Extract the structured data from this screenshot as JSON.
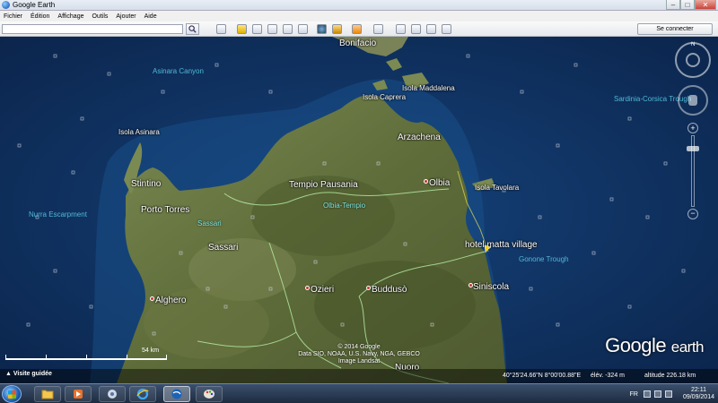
{
  "window": {
    "title": "Google Earth"
  },
  "menu": [
    "Fichier",
    "Édition",
    "Affichage",
    "Outils",
    "Ajouter",
    "Aide"
  ],
  "toolbar": {
    "search_value": "",
    "signin_label": "Se connecter"
  },
  "map": {
    "places": {
      "bonifacio": "Bonifacio",
      "isola_maddalena": "Isola Maddalena",
      "isola_caprera": "Isola Caprera",
      "isola_asinara": "Isola Asinara",
      "arzachena": "Arzachena",
      "stintino": "Stintino",
      "porto_torres": "Porto Torres",
      "sassari_prov": "Sassari",
      "tempio": "Tempio Pausania",
      "olbia_tempio": "Olbia-Tempio",
      "olbia": "Olbia",
      "isola_tavolara": "Isola Tavolara",
      "sassari": "Sassari",
      "hotel": "hotel matta village",
      "alghero": "Alghero",
      "ozieri": "Ozieri",
      "budduso": "Buddusò",
      "siniscola": "Siniscola",
      "nuoro": "Nuoro"
    },
    "ocean_labels": {
      "asinara_canyon": "Asinara Canyon",
      "sardinia_corsica": "Sardinia-Corsica Trough",
      "nurra_escarpment": "Nurra Escarpment",
      "gonone_trough": "Gonone Trough"
    },
    "scale_label": "54 km",
    "copyright": [
      "© 2014 Google",
      "Data SIO, NOAA, U.S. Navy, NGA, GEBCO",
      "Image Landsat"
    ],
    "logo": {
      "main": "Google",
      "sub": "earth"
    },
    "compass_letter": "N"
  },
  "status": {
    "guided_tour": "Visite guidée",
    "coords": "40°25'24.66\"N    8°00'00.88\"E",
    "elevation": "élév.  -324 m",
    "altitude": "altitude 226.18 km"
  },
  "taskbar": {
    "language": "FR",
    "time": "22:11",
    "date": "09/09/2014"
  },
  "colors": {
    "sea": "#0c2c57",
    "land": "#6b7a45",
    "border": "#b8f0a8",
    "pin_hotel": "#f5d200"
  }
}
